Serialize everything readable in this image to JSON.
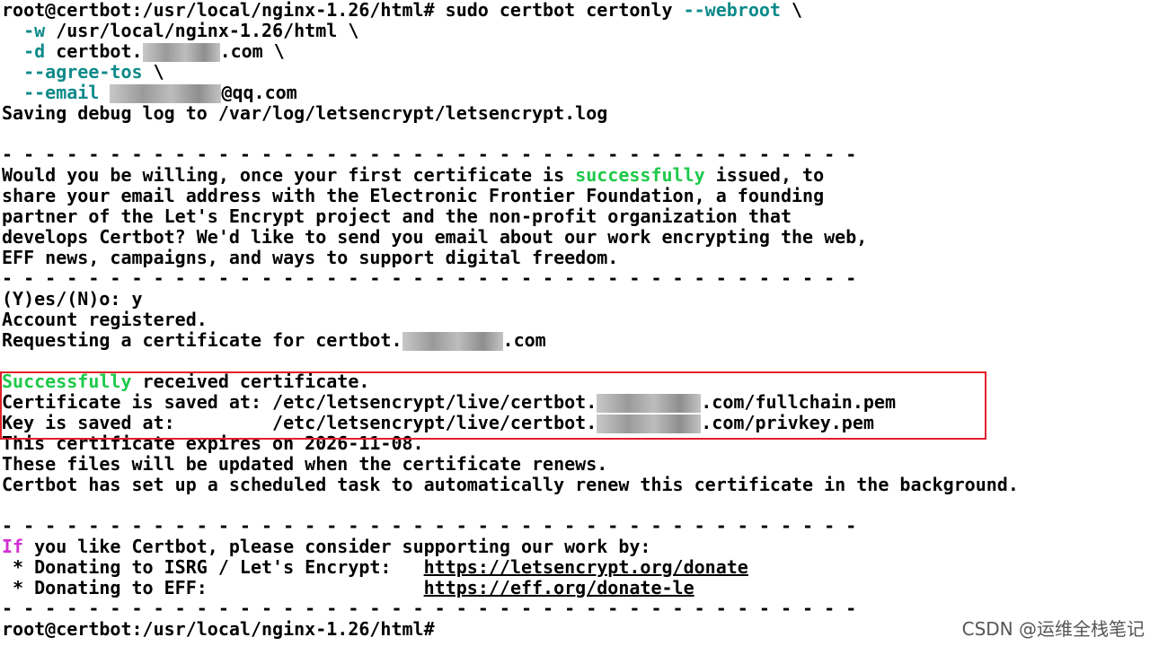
{
  "terminal": {
    "cmd_line1_prompt": "root@certbot:/usr/local/nginx-1.26/html#",
    "cmd_line1_cmd": " sudo certbot certonly ",
    "cmd_line1_flag": "--webroot",
    "cmd_line1_end": " \\",
    "cmd_line2_flag": "-w",
    "cmd_line2_rest": " /usr/local/nginx-1.26/html \\",
    "cmd_line3_flag": "-d",
    "cmd_line3_pre": " certbot.",
    "cmd_line3_post": ".com \\",
    "cmd_line4_flag": "--agree-tos",
    "cmd_line4_rest": " \\",
    "cmd_line5_flag": "--email",
    "cmd_line5_post": "@qq.com",
    "debug_log": "Saving debug log to /var/log/letsencrypt/letsencrypt.log",
    "divider": "- - - - - - - - - - - - - - - - - - - - - - - - - - - - - - - - - - - - - - - -",
    "eff_q1_pre": "Would you be willing, once your first certificate is ",
    "eff_q1_green": "successfully",
    "eff_q1_post": " issued, to",
    "eff_q2": "share your email address with the Electronic Frontier Foundation, a founding",
    "eff_q3": "partner of the Let's Encrypt project and the non-profit organization that",
    "eff_q4": "develops Certbot? We'd like to send you email about our work encrypting the web,",
    "eff_q5": "EFF news, campaigns, and ways to support digital freedom.",
    "yes_no": "(Y)es/(N)o: y",
    "account": "Account registered.",
    "requesting_pre": "Requesting a certificate for certbot.",
    "requesting_post": ".com",
    "success_green": "Successfully",
    "success_rest": " received certificate.",
    "cert_saved_pre": "Certificate is saved at: /etc/letsencrypt/live/certbot.",
    "cert_saved_post": ".com/fullchain.pem",
    "key_saved_pre": "Key is saved at:         /etc/letsencrypt/live/certbot.",
    "key_saved_post": ".com/privkey.pem",
    "expires": "This certificate expires on 2026-11-08.",
    "renew": "These files will be updated when the certificate renews.",
    "scheduled": "Certbot has set up a scheduled task to automatically renew this certificate in the background.",
    "support_if": "If",
    "support_rest": " you like Certbot, please consider supporting our work by:",
    "donate_isrg_label": " * Donating to ISRG / Let's Encrypt:   ",
    "donate_isrg_link": "https://letsencrypt.org/donate",
    "donate_eff_label": " * Donating to EFF:                    ",
    "donate_eff_link": "https://eff.org/donate-le",
    "final_prompt": "root@certbot:/usr/local/nginx-1.26/html#"
  },
  "watermark": "CSDN @运维全栈笔记",
  "colors": {
    "flag": "#0e8a8a",
    "success": "#1ec94a",
    "keyword_if": "#d12fd1",
    "highlight_border": "#e0202a"
  }
}
